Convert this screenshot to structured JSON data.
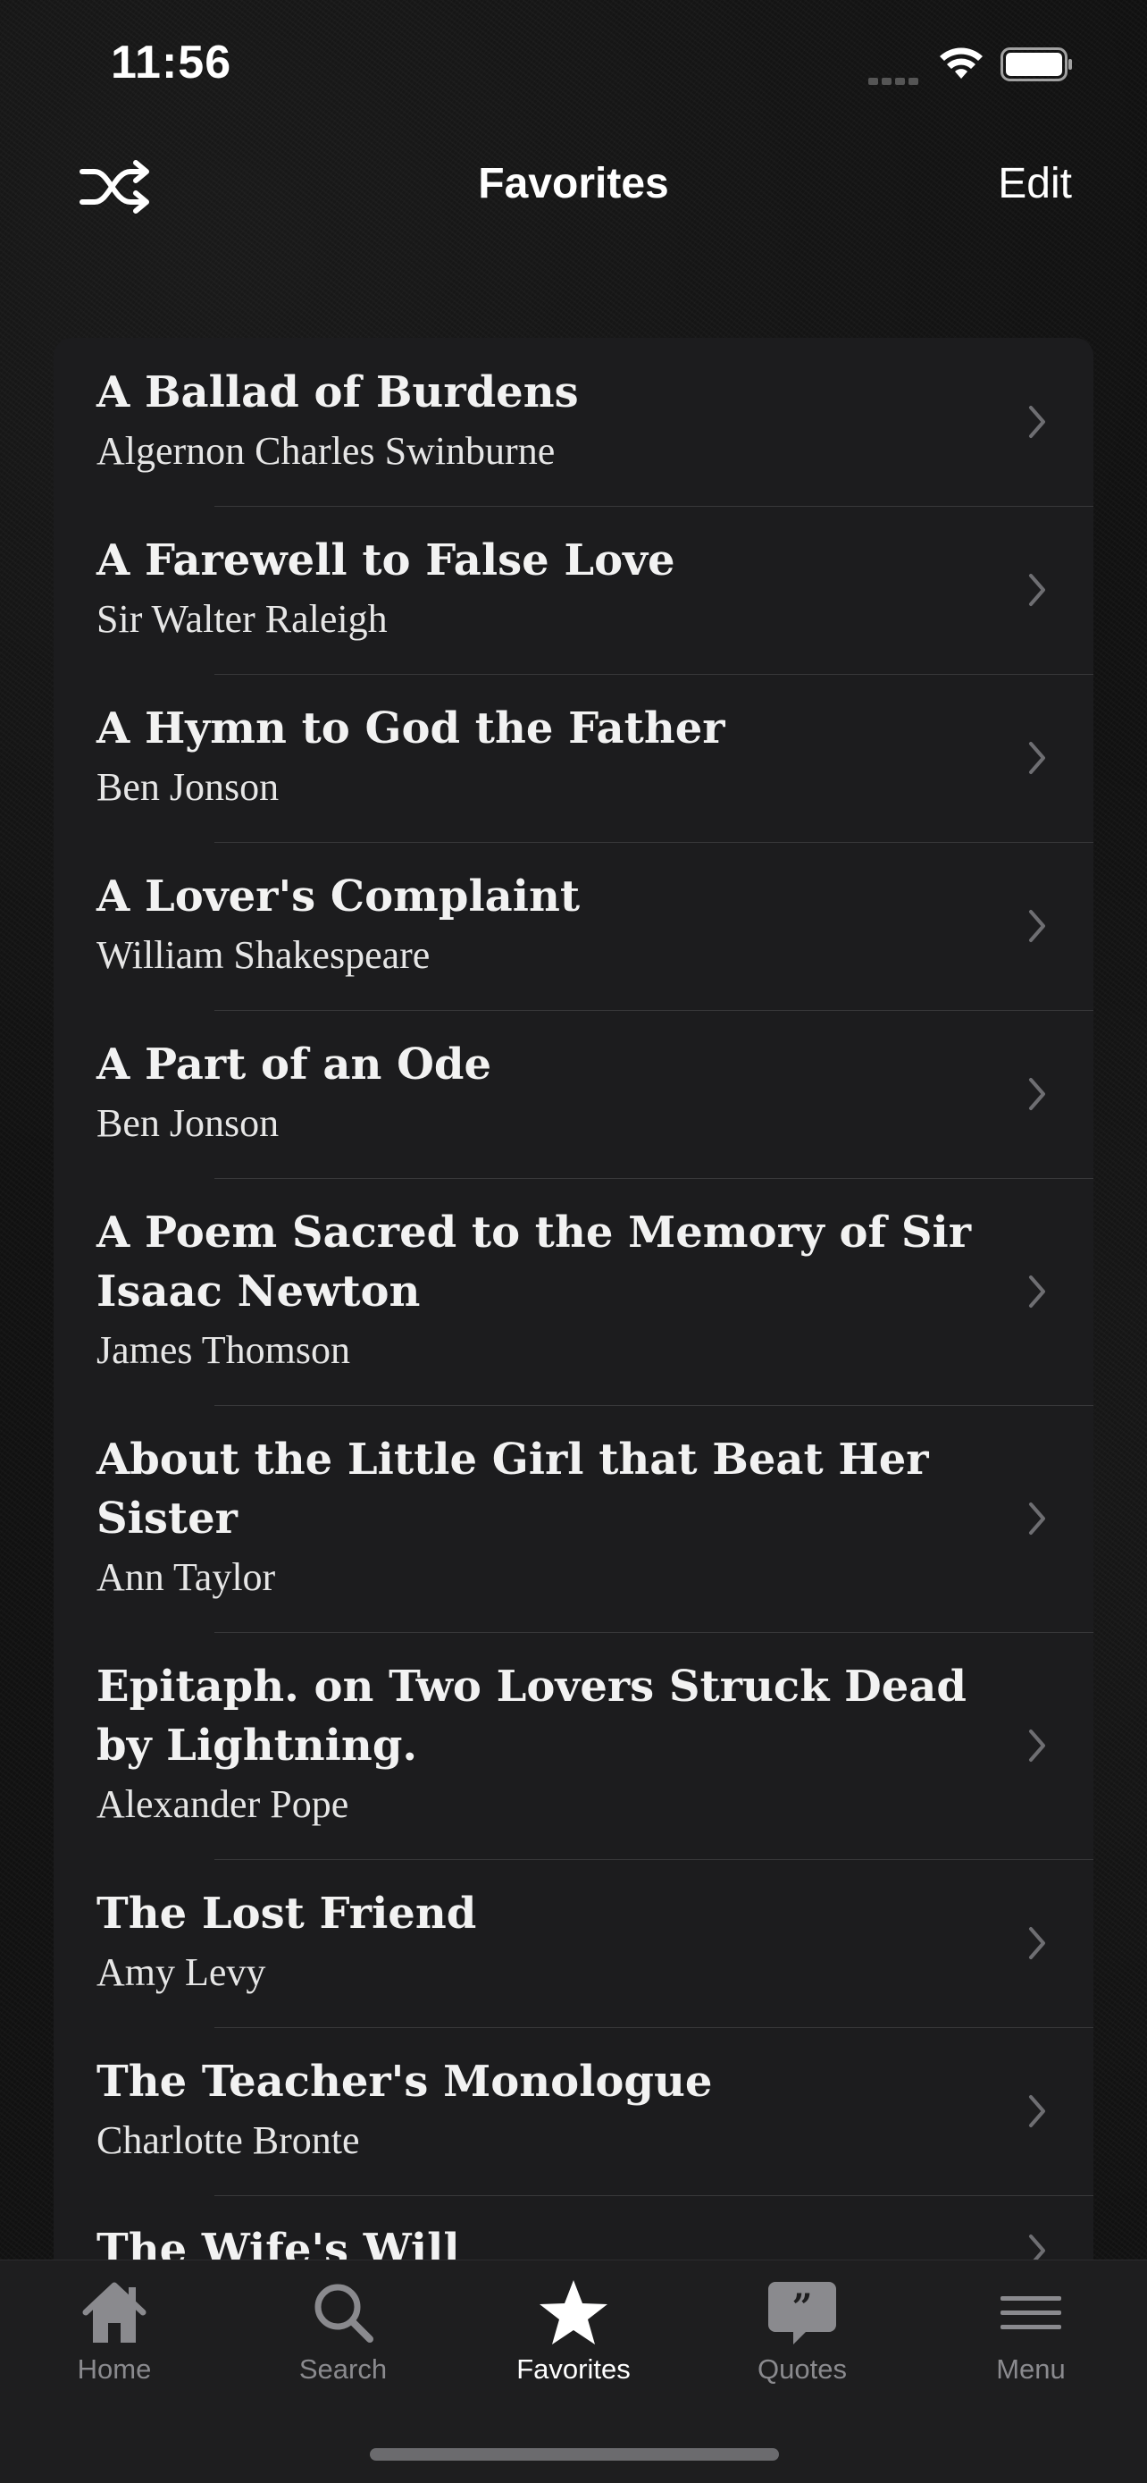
{
  "status_bar": {
    "time": "11:56"
  },
  "nav": {
    "title": "Favorites",
    "edit_label": "Edit",
    "left_icon": "shuffle-icon"
  },
  "poems": [
    {
      "title": "A Ballad of Burdens",
      "author": "Algernon Charles Swinburne"
    },
    {
      "title": "A Farewell to False Love",
      "author": "Sir Walter Raleigh"
    },
    {
      "title": "A Hymn to God the Father",
      "author": "Ben Jonson"
    },
    {
      "title": "A Lover's Complaint",
      "author": "William Shakespeare"
    },
    {
      "title": "A Part of an Ode",
      "author": "Ben Jonson"
    },
    {
      "title": "A Poem Sacred to the Memory of Sir Isaac Newton",
      "author": "James Thomson"
    },
    {
      "title": "About the Little Girl that Beat Her Sister",
      "author": "Ann Taylor"
    },
    {
      "title": "Epitaph. on Two Lovers Struck Dead by Lightning.",
      "author": "Alexander Pope"
    },
    {
      "title": "The Lost Friend",
      "author": "Amy Levy"
    },
    {
      "title": "The Teacher's Monologue",
      "author": "Charlotte Bronte"
    },
    {
      "title": "The Wife's Will",
      "author": ""
    }
  ],
  "tabs": [
    {
      "label": "Home",
      "icon": "home-icon"
    },
    {
      "label": "Search",
      "icon": "search-icon"
    },
    {
      "label": "Favorites",
      "icon": "star-icon",
      "active": true
    },
    {
      "label": "Quotes",
      "icon": "quote-bubble-icon"
    },
    {
      "label": "Menu",
      "icon": "menu-icon"
    }
  ],
  "colors": {
    "background": "#111111",
    "card": "#1c1c1e",
    "tab_inactive": "#8a8a8e",
    "tab_active": "#ffffff"
  }
}
